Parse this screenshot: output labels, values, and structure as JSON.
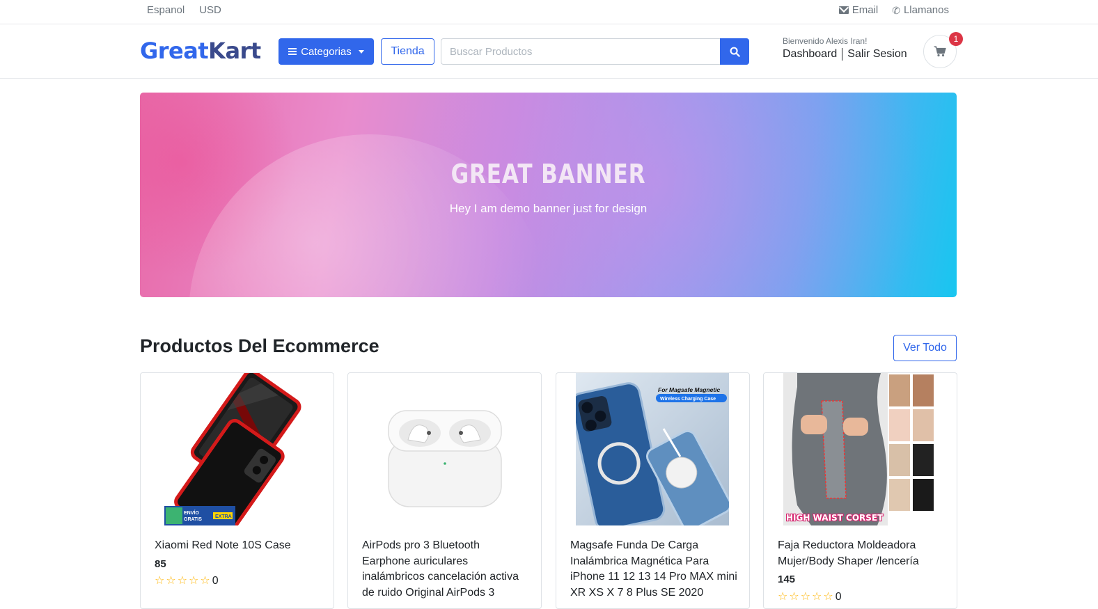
{
  "topbar": {
    "language": "Espanol",
    "currency": "USD",
    "email_label": "Email",
    "call_label": "Llamanos"
  },
  "header": {
    "logo_part1": "Great",
    "logo_part2": "Kart",
    "categories_label": "Categorias",
    "store_label": "Tienda",
    "search_placeholder": "Buscar Productos",
    "welcome": "Bienvenido Alexis Iran!",
    "dashboard_label": "Dashboard",
    "logout_label": "Salir Sesion",
    "cart_count": "1"
  },
  "banner": {
    "title": "GREAT BANNER",
    "subtitle": "Hey I am demo banner just for design"
  },
  "products_section": {
    "title": "Productos Del Ecommerce",
    "view_all_label": "Ver Todo",
    "items": [
      {
        "name": "Xiaomi Red Note 10S Case",
        "price": "85",
        "rating_count": "0",
        "image_caption": "ENVÍO GRATIS EXTRA",
        "image_icon": "phone-case-image"
      },
      {
        "name": "AirPods pro 3 Bluetooth Earphone auriculares inalámbricos cancelación activa de ruido Original AirPods 3",
        "price": "",
        "rating_count": "",
        "image_caption": "",
        "image_icon": "airpods-image"
      },
      {
        "name": "Magsafe Funda De Carga Inalámbrica Magnética Para iPhone 11 12 13 14 Pro MAX mini XR XS X 7 8 Plus SE 2020",
        "price": "",
        "rating_count": "",
        "image_caption": "For Magsafe Magnetic",
        "image_caption2": "Wireless Charging Case",
        "image_icon": "iphone-case-image"
      },
      {
        "name": "Faja Reductora Moldeadora Mujer/Body Shaper /lencería",
        "price": "145",
        "rating_count": "0",
        "image_caption": "HIGH WAIST CORSET",
        "image_icon": "corset-image"
      }
    ]
  },
  "colors": {
    "primary": "#3167eb",
    "badge": "#dc3545",
    "star": "#ffb400"
  }
}
